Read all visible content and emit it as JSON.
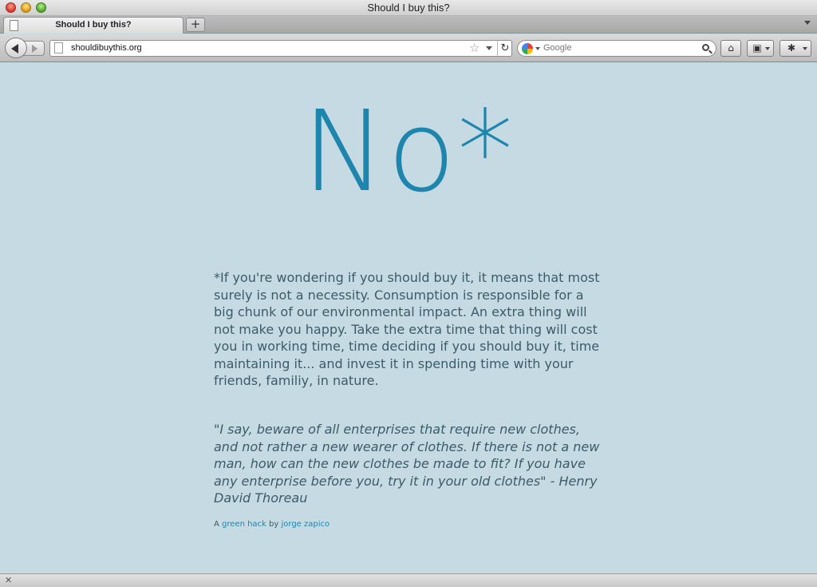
{
  "window": {
    "title": "Should I buy this?"
  },
  "tabs": [
    {
      "title": "Should I buy this?"
    }
  ],
  "tab_bar": {
    "new_tab_label": "+"
  },
  "navigation": {
    "url": "shouldibuythis.org",
    "search_placeholder": "Google"
  },
  "page": {
    "headline": "No*",
    "body": "*If you're wondering if you should buy it, it means that most surely is not a necessity. Consumption is responsible for a big chunk of our environmental impact. An extra thing will not make you happy. Take the extra time that thing will cost you in working time, time deciding if you should buy it, time maintaining it... and invest it in spending time with your friends, familiy, in nature.",
    "quote": "\"I say, beware of all enterprises that require new clothes, and not rather a new wearer of clothes. If there is not a new man, how can the new clothes be made to fit? If you have any enterprise before you, try it in your old clothes\" - Henry David Thoreau",
    "credit": {
      "prefix": "A",
      "link1": "green hack",
      "middle": "by",
      "link2": "jorge zapico"
    }
  },
  "colors": {
    "background": "#c6dae3",
    "headline": "#1e86ad",
    "text": "#3c5b69",
    "link": "#1e86ad"
  }
}
